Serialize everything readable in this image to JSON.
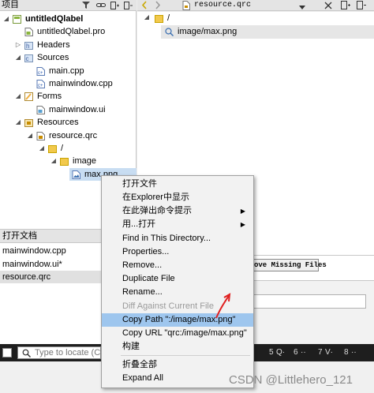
{
  "colors": {
    "accent": "#9ec6ee",
    "selection": "#c8ddf2",
    "taskbar": "#1e1e1e",
    "folder": "#f2c94c",
    "forms": "#f0b040"
  },
  "left_panel": {
    "title": "项目",
    "tree": [
      {
        "label": "untitledQlabel",
        "icon": "project-icon"
      },
      {
        "label": "untitledQlabel.pro",
        "icon": "pro-file-icon"
      },
      {
        "label": "Headers",
        "icon": "headers-folder-icon"
      },
      {
        "label": "Sources",
        "icon": "sources-folder-icon"
      },
      {
        "label": "main.cpp",
        "icon": "cpp-file-icon"
      },
      {
        "label": "mainwindow.cpp",
        "icon": "cpp-file-icon"
      },
      {
        "label": "Forms",
        "icon": "forms-folder-icon"
      },
      {
        "label": "mainwindow.ui",
        "icon": "ui-file-icon"
      },
      {
        "label": "Resources",
        "icon": "resources-folder-icon"
      },
      {
        "label": "resource.qrc",
        "icon": "qrc-file-icon"
      },
      {
        "label": "/",
        "icon": "folder-icon"
      },
      {
        "label": "image",
        "icon": "folder-icon"
      },
      {
        "label": "max.png",
        "icon": "image-file-icon"
      }
    ]
  },
  "open_docs": {
    "title": "打开文档",
    "items": [
      "mainwindow.cpp",
      "mainwindow.ui*",
      "resource.qrc"
    ]
  },
  "editor": {
    "tab_label": "resource.qrc",
    "tree": [
      {
        "label": "/",
        "icon": "folder-icon"
      },
      {
        "label": "image/max.png",
        "icon": "zoom-image-icon"
      }
    ],
    "remove_missing_button": "ove Missing Files"
  },
  "context_menu": {
    "items": [
      {
        "label": "打开文件",
        "submenu": false,
        "disabled": false
      },
      {
        "label": "在Explorer中显示",
        "submenu": false,
        "disabled": false
      },
      {
        "label": "在此弹出命令提示",
        "submenu": true,
        "disabled": false
      },
      {
        "label": "用...打开",
        "submenu": true,
        "disabled": false
      },
      {
        "label": "Find in This Directory...",
        "submenu": false,
        "disabled": false
      },
      {
        "label": "Properties...",
        "submenu": false,
        "disabled": false
      },
      {
        "label": "Remove...",
        "submenu": false,
        "disabled": false
      },
      {
        "label": "Duplicate File",
        "submenu": false,
        "disabled": false
      },
      {
        "label": "Rename...",
        "submenu": false,
        "disabled": false
      },
      {
        "label": "Diff Against Current File",
        "submenu": false,
        "disabled": true
      },
      {
        "label": "Copy Path \":/image/max.png\"",
        "submenu": false,
        "disabled": false,
        "highlighted": true
      },
      {
        "label": "Copy URL \"qrc:/image/max.png\"",
        "submenu": false,
        "disabled": false
      },
      {
        "label": "构建",
        "submenu": false,
        "disabled": false
      },
      {
        "label": "折叠全部",
        "submenu": false,
        "disabled": false
      },
      {
        "label": "Expand All",
        "submenu": false,
        "disabled": false
      }
    ]
  },
  "status_bar": {
    "locator_placeholder": "Type to locate (Ctr",
    "pane_numbers": [
      "5",
      "6",
      "7",
      "8"
    ],
    "pane_labels": [
      "Q·",
      "··",
      "V·",
      "··"
    ]
  },
  "watermark": "CSDN @Littlehero_121"
}
